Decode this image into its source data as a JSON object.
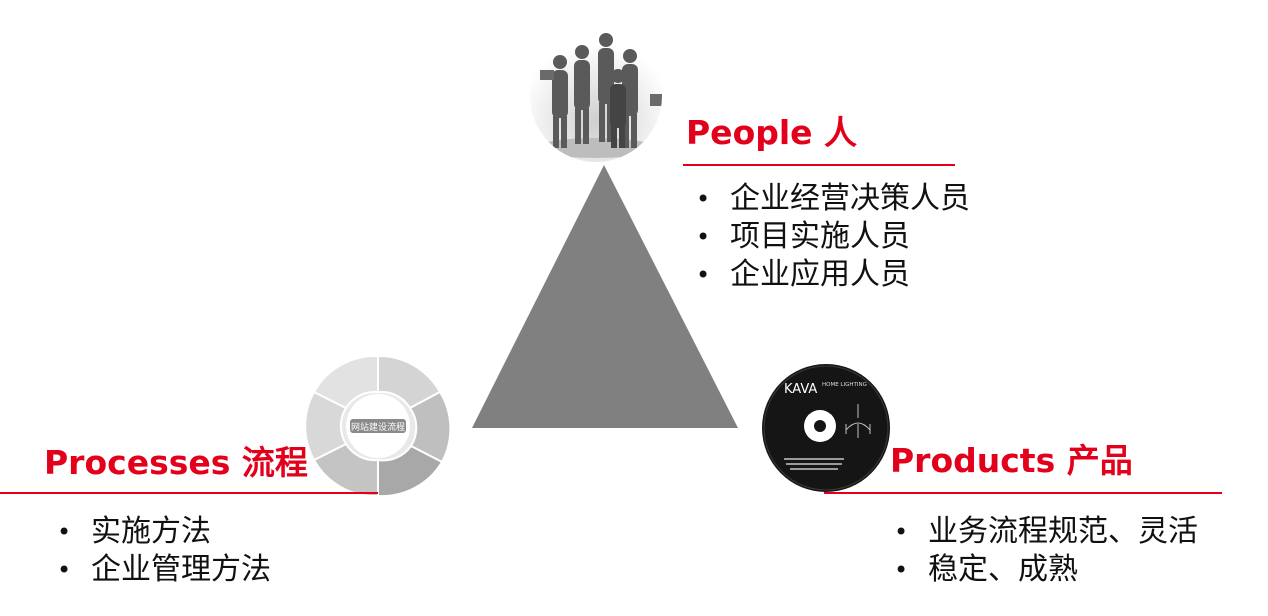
{
  "colors": {
    "accent": "#e3001b",
    "triangle": "#808080"
  },
  "people": {
    "heading": "People 人",
    "items": [
      "企业经营决策人员",
      "项目实施人员",
      "企业应用人员"
    ]
  },
  "processes": {
    "heading": "Processes 流程",
    "items": [
      "实施方法",
      "企业管理方法"
    ]
  },
  "products": {
    "heading": "Products 产品",
    "items": [
      "业务流程规范、灵活",
      "稳定、成熟"
    ]
  },
  "disc": {
    "brand": "KAVA",
    "subtitle": "HOME LIGHTING"
  },
  "cycle_center": "网站建设流程"
}
